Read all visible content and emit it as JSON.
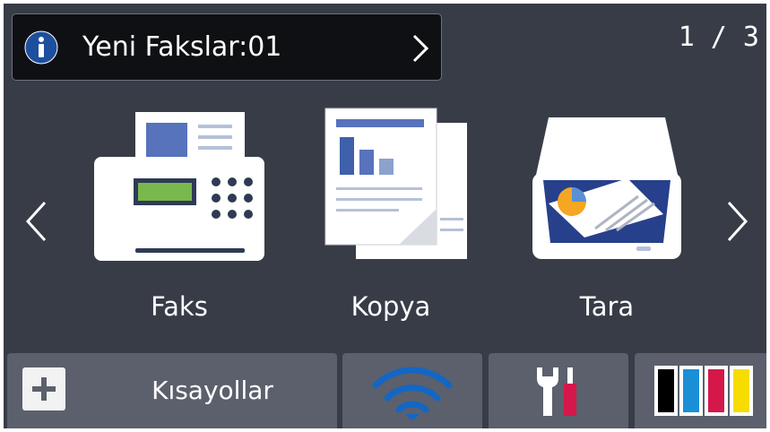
{
  "notification": {
    "text": "Yeni Fakslar:01",
    "icon": "info-icon",
    "chevron_icon": "chevron-right-icon"
  },
  "page_indicator": "1 / 3",
  "carousel": {
    "left_arrow_icon": "chevron-left-icon",
    "right_arrow_icon": "chevron-right-icon",
    "apps": [
      {
        "label": "Faks",
        "icon": "fax-machine-icon"
      },
      {
        "label": "Kopya",
        "icon": "copy-documents-icon"
      },
      {
        "label": "Tara",
        "icon": "scanner-icon"
      }
    ]
  },
  "bottom_bar": {
    "shortcuts": {
      "label": "Kısayollar",
      "icon": "plus-icon"
    },
    "wifi": {
      "icon": "wifi-icon"
    },
    "tools": {
      "icon": "wrench-screwdriver-icon"
    },
    "ink": {
      "icon": "ink-cartridges-icon",
      "colors": [
        "#000000",
        "#1a8fd6",
        "#d6174a",
        "#f7dc00"
      ]
    }
  },
  "colors": {
    "background": "#373c47",
    "tile": "#5b606c",
    "info_blue": "#1d4f9e",
    "wifi_blue": "#1466c4"
  }
}
